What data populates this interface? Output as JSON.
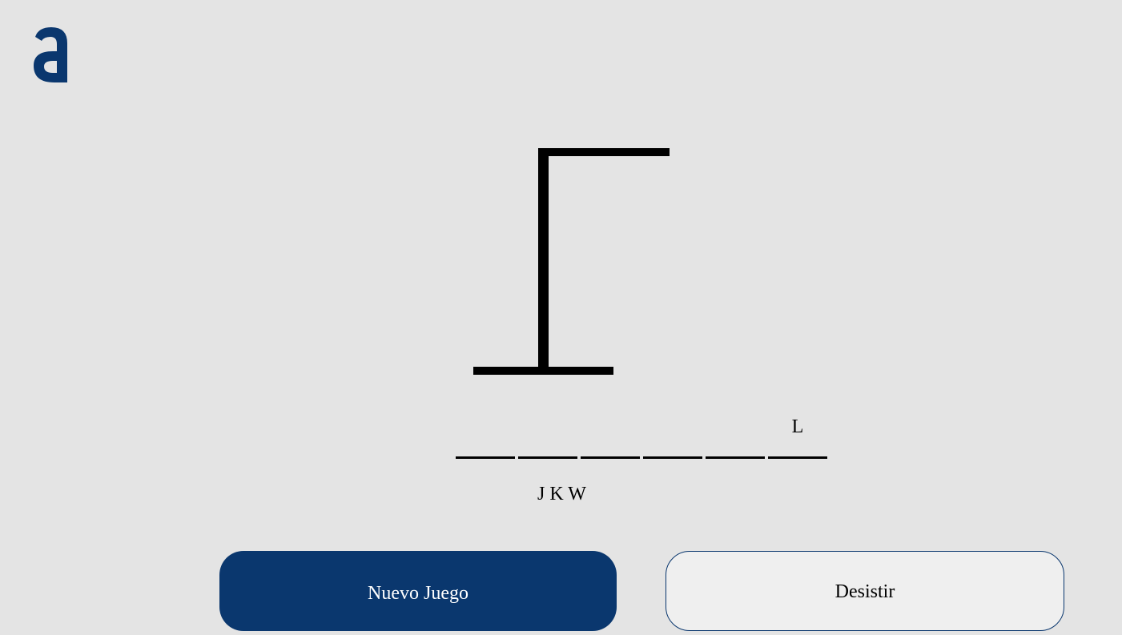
{
  "logo": {
    "icon": "alura-a-logo-icon",
    "color": "#0a376e"
  },
  "game": {
    "word_slots": [
      "",
      "",
      "",
      "",
      "",
      "L"
    ],
    "wrong_letters": "J K W"
  },
  "buttons": {
    "new_game_label": "Nuevo Juego",
    "quit_label": "Desistir"
  },
  "colors": {
    "background": "#e4e4e4",
    "primary": "#0a376e",
    "secondary_button": "#efefef"
  }
}
